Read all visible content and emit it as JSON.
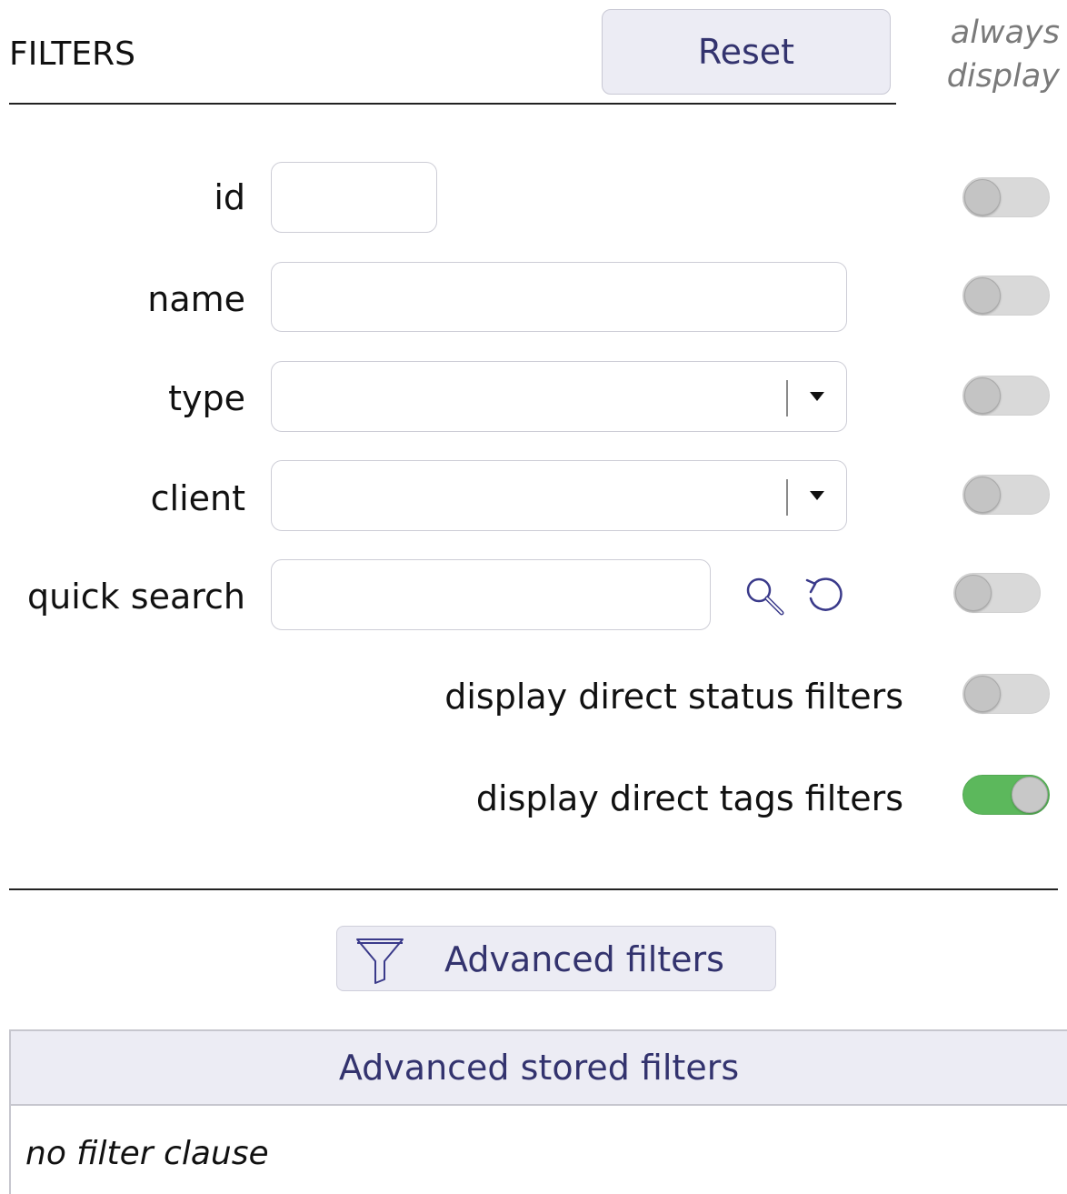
{
  "header": {
    "title": "FILTERS",
    "reset_label": "Reset",
    "always_display_line1": "always",
    "always_display_line2": "display"
  },
  "fields": {
    "id": {
      "label": "id",
      "value": "",
      "always_display": false
    },
    "name": {
      "label": "name",
      "value": "",
      "always_display": false
    },
    "type": {
      "label": "type",
      "selected": "",
      "always_display": false
    },
    "client": {
      "label": "client",
      "selected": "",
      "always_display": false
    },
    "quick_search": {
      "label": "quick search",
      "value": "",
      "always_display": false
    }
  },
  "options": {
    "direct_status": {
      "label": "display direct status filters",
      "enabled": false
    },
    "direct_tags": {
      "label": "display direct tags filters",
      "enabled": true
    }
  },
  "advanced": {
    "button_label": "Advanced filters",
    "stored_title": "Advanced stored filters",
    "empty_text": "no filter clause"
  },
  "icons": {
    "quick_search_go": "magnifier-icon",
    "quick_search_reset": "refresh-icon",
    "advanced": "funnel-icon",
    "dropdown": "caret-down-icon"
  },
  "colors": {
    "toggle_on": "#5cb85c",
    "toggle_off": "#d9d9d9",
    "button_bg": "#ececf4",
    "button_text": "#33336e",
    "icon_color": "#3a3a8a"
  }
}
